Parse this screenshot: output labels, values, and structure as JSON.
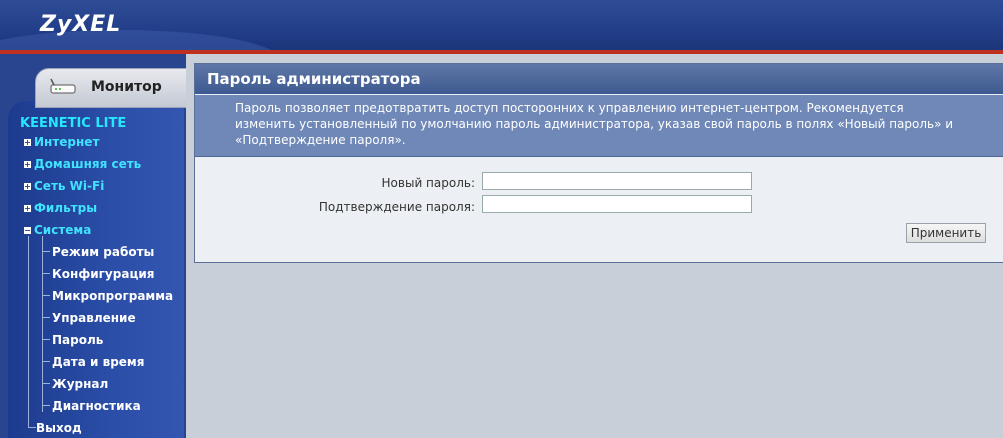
{
  "header": {
    "logo": "ZyXEL"
  },
  "sidebar": {
    "monitor_label": "Монитор",
    "brand": "KEENETIC LITE",
    "top_items": [
      {
        "label": "Интернет",
        "expand": "+"
      },
      {
        "label": "Домашняя сеть",
        "expand": "+"
      },
      {
        "label": "Сеть Wi-Fi",
        "expand": "+"
      },
      {
        "label": "Фильтры",
        "expand": "+"
      },
      {
        "label": "Система",
        "expand": "−"
      }
    ],
    "sub_items": [
      "Режим работы",
      "Конфигурация",
      "Микропрограмма",
      "Управление",
      "Пароль",
      "Дата и время",
      "Журнал",
      "Диагностика"
    ],
    "exit_label": "Выход"
  },
  "panel": {
    "title": "Пароль администратора",
    "description": "Пароль позволяет предотвратить доступ посторонних к управлению интернет-центром. Рекомендуется изменить установленный по умолчанию пароль администратора, указав свой пароль в полях «Новый пароль» и «Подтверждение пароля».",
    "new_password_label": "Новый пароль:",
    "new_password_value": "",
    "confirm_password_label": "Подтверждение пароля:",
    "confirm_password_value": "",
    "apply_label": "Применить"
  },
  "colors": {
    "header_bg": "#223e88",
    "accent_red": "#c03020",
    "nav_cyan": "#3fe3ff",
    "panel_desc_bg": "#6f88b8"
  }
}
